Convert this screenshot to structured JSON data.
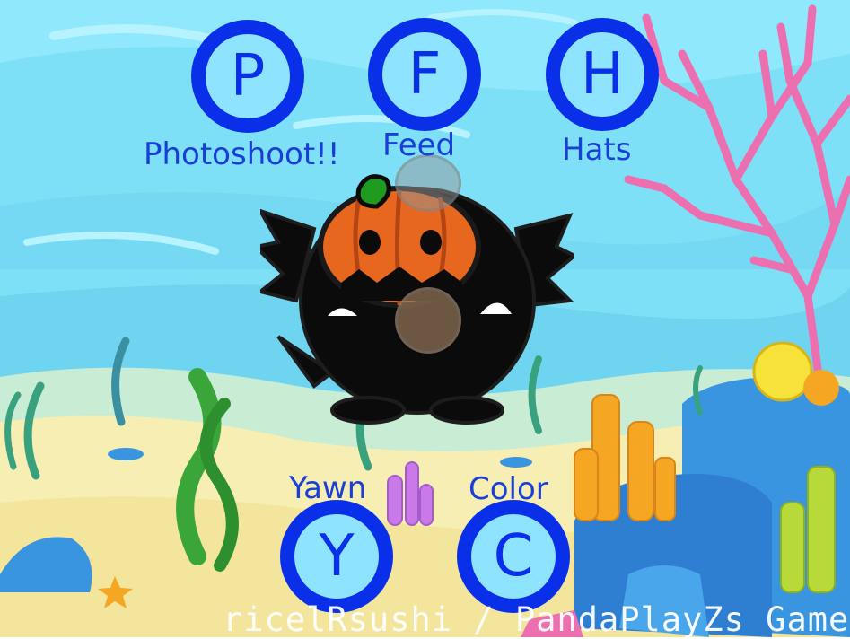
{
  "buttons": {
    "photoshoot": {
      "letter": "P",
      "label": "Photoshoot!!"
    },
    "feed": {
      "letter": "F",
      "label": "Feed"
    },
    "hats": {
      "letter": "H",
      "label": "Hats"
    },
    "yawn": {
      "letter": "Y",
      "label": "Yawn"
    },
    "color": {
      "letter": "C",
      "label": "Color"
    }
  },
  "credit": "ricelRsushi / PandaPlayZs Game",
  "colors": {
    "button_ring": "#0a2fe8",
    "button_fill": "#8ee3ff",
    "label_text": "#1a3fd8",
    "water": "#7ee0f7",
    "sand": "#f6eeb2",
    "coral_pink": "#ec6fb0"
  },
  "character": {
    "hat": "jack-o-lantern",
    "body_color": "black"
  }
}
